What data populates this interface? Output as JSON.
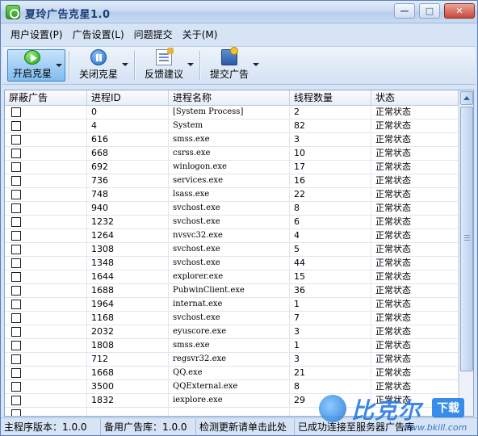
{
  "window": {
    "title": "夏玲广告克星1.0",
    "controls": {
      "minimize": "—",
      "maximize": "□",
      "close": "✕"
    }
  },
  "menu": [
    {
      "label": "用户设置(P)"
    },
    {
      "label": "广告设置(L)"
    },
    {
      "label": "问题提交"
    },
    {
      "label": "关于(M)"
    }
  ],
  "toolbar": [
    {
      "label": "开启克星",
      "icon": "play-icon",
      "active": true
    },
    {
      "label": "关闭克星",
      "icon": "pause-icon",
      "active": false
    },
    {
      "label": "反馈建议",
      "icon": "feedback-icon",
      "active": false
    },
    {
      "label": "提交广告",
      "icon": "submit-ad-icon",
      "active": false
    }
  ],
  "table": {
    "columns": [
      "屏蔽广告",
      "进程ID",
      "进程名称",
      "线程数量",
      "状态"
    ],
    "rows": [
      {
        "pid": "0",
        "name": "[System Process]",
        "threads": "2",
        "status": "正常状态",
        "blocked": false
      },
      {
        "pid": "4",
        "name": "System",
        "threads": "82",
        "status": "正常状态",
        "blocked": false
      },
      {
        "pid": "616",
        "name": "smss.exe",
        "threads": "3",
        "status": "正常状态",
        "blocked": false
      },
      {
        "pid": "668",
        "name": "csrss.exe",
        "threads": "10",
        "status": "正常状态",
        "blocked": false
      },
      {
        "pid": "692",
        "name": "winlogon.exe",
        "threads": "17",
        "status": "正常状态",
        "blocked": false
      },
      {
        "pid": "736",
        "name": "services.exe",
        "threads": "16",
        "status": "正常状态",
        "blocked": false
      },
      {
        "pid": "748",
        "name": "lsass.exe",
        "threads": "22",
        "status": "正常状态",
        "blocked": false
      },
      {
        "pid": "940",
        "name": "svchost.exe",
        "threads": "8",
        "status": "正常状态",
        "blocked": false
      },
      {
        "pid": "1232",
        "name": "svchost.exe",
        "threads": "6",
        "status": "正常状态",
        "blocked": false
      },
      {
        "pid": "1264",
        "name": "nvsvc32.exe",
        "threads": "4",
        "status": "正常状态",
        "blocked": false
      },
      {
        "pid": "1308",
        "name": "svchost.exe",
        "threads": "5",
        "status": "正常状态",
        "blocked": false
      },
      {
        "pid": "1348",
        "name": "svchost.exe",
        "threads": "44",
        "status": "正常状态",
        "blocked": false
      },
      {
        "pid": "1644",
        "name": "explorer.exe",
        "threads": "15",
        "status": "正常状态",
        "blocked": false
      },
      {
        "pid": "1688",
        "name": "PubwinClient.exe",
        "threads": "36",
        "status": "正常状态",
        "blocked": false
      },
      {
        "pid": "1964",
        "name": "internat.exe",
        "threads": "1",
        "status": "正常状态",
        "blocked": false
      },
      {
        "pid": "1168",
        "name": "svchost.exe",
        "threads": "7",
        "status": "正常状态",
        "blocked": false
      },
      {
        "pid": "2032",
        "name": "eyuscore.exe",
        "threads": "3",
        "status": "正常状态",
        "blocked": false
      },
      {
        "pid": "1808",
        "name": "smss.exe",
        "threads": "1",
        "status": "正常状态",
        "blocked": false
      },
      {
        "pid": "712",
        "name": "regsvr32.exe",
        "threads": "3",
        "status": "正常状态",
        "blocked": false
      },
      {
        "pid": "1668",
        "name": "QQ.exe",
        "threads": "21",
        "status": "正常状态",
        "blocked": false
      },
      {
        "pid": "3500",
        "name": "QQExternal.exe",
        "threads": "8",
        "status": "正常状态",
        "blocked": false
      },
      {
        "pid": "1832",
        "name": "iexplore.exe",
        "threads": "29",
        "status": "正常状态",
        "blocked": false
      },
      {
        "pid": "",
        "name": "",
        "threads": "",
        "status": "",
        "blocked": false
      }
    ]
  },
  "statusbar": {
    "main_version": "主程序版本：1.0.0",
    "ad_lib_version": "备用广告库：1.0.0",
    "update": "检测更新请单击此处",
    "connection": "已成功连接至服务器广告库"
  },
  "watermark": {
    "brand": "比克尔",
    "badge": "下载",
    "url": "www.bkill.com"
  }
}
